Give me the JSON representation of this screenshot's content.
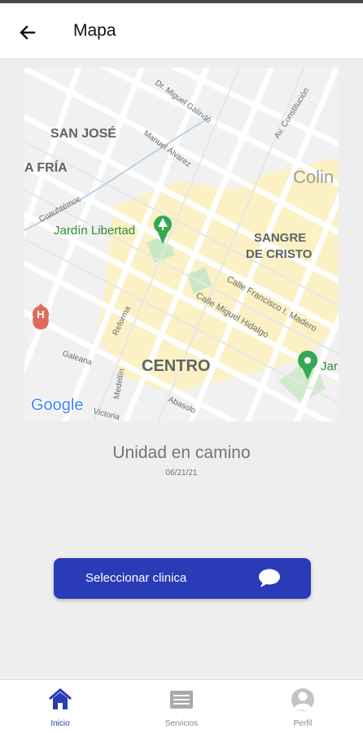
{
  "appbar": {
    "title": "Mapa",
    "back_icon": "arrow-left-icon"
  },
  "map": {
    "labels": {
      "san_jose": "SAN JOSÉ",
      "a_fria": "A FRÍA",
      "colin": "Colin",
      "jardin_libertad": "Jardín Libertad",
      "sangre": "SANGRE",
      "de_cristo": "DE CRISTO",
      "centro": "CENTRO",
      "jar": "Jar",
      "google": "Google",
      "st_galindo": "Dr. Miguel Galindo",
      "st_alvarez": "Manuel Álvarez",
      "st_constitucion": "Av. Constitución",
      "st_cuauhtemoc": "Cuauhtémoc",
      "st_madero": "Calle Francisco I. Madero",
      "st_hidalgo": "Calle Miguel Hidalgo",
      "st_reforma": "Reforma",
      "st_galeana": "Galeana",
      "st_medellin": "Medellín",
      "st_abasolo": "Abasolo",
      "st_victoria": "Victoria"
    }
  },
  "status": {
    "text": "Unidad en camino",
    "date": "06/21/21"
  },
  "action": {
    "label": "Seleccionar clinica",
    "icon": "chat-bubble-icon"
  },
  "nav": [
    {
      "label": "Inicio",
      "icon": "home-icon",
      "active": true
    },
    {
      "label": "Servicios",
      "icon": "list-icon",
      "active": false
    },
    {
      "label": "Perfil",
      "icon": "user-icon",
      "active": false
    }
  ],
  "colors": {
    "accent": "#2a3bb8",
    "map_block": "#fbf1c4",
    "park": "#c9e9c4",
    "marker_green": "#34a853",
    "marker_red": "#e06a5c"
  }
}
